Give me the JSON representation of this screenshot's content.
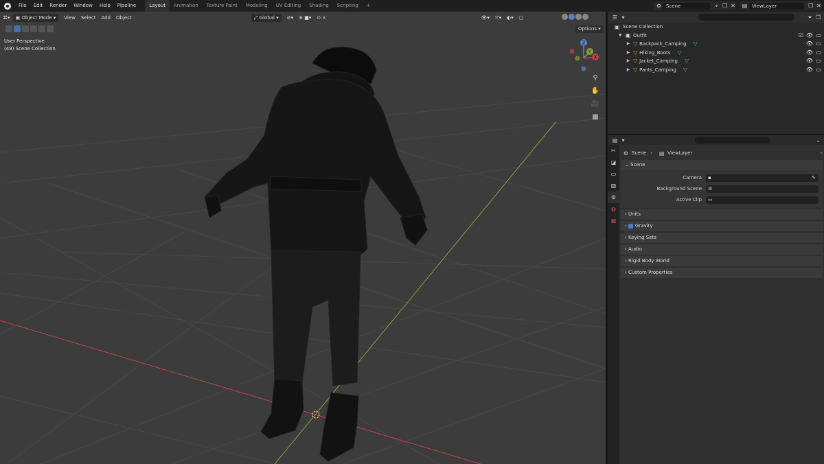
{
  "topbar": {
    "menu": [
      "File",
      "Edit",
      "Render",
      "Window",
      "Help",
      "Pipeline"
    ],
    "workspaces": [
      "Layout",
      "Animation",
      "Texture Paint",
      "Modeling",
      "UV Editing",
      "Shading",
      "Scripting",
      "+"
    ],
    "scene": "Scene",
    "view_layer": "ViewLayer"
  },
  "viewport": {
    "mode": "Object Mode",
    "header_menu": [
      "View",
      "Select",
      "Add",
      "Object"
    ],
    "orientation": "Global",
    "options": "Options",
    "perspective": "User Perspective",
    "collection_info": "(49) Scene Collection",
    "gizmo_axes": [
      "Z",
      "Y",
      "X"
    ]
  },
  "outliner": {
    "root": "Scene Collection",
    "collection": "Outfit",
    "objects": [
      "Backpack_Camping",
      "Hiking_Boots",
      "Jacket_Camping",
      "Pants_Camping"
    ]
  },
  "properties": {
    "breadcrumb": [
      "Scene",
      "ViewLayer"
    ],
    "scene_panel": "Scene",
    "fields": [
      {
        "label": "Camera"
      },
      {
        "label": "Background Scene"
      },
      {
        "label": "Active Clip"
      }
    ],
    "panels": [
      "Units",
      "Gravity",
      "Keying Sets",
      "Audio",
      "Rigid Body World",
      "Custom Properties"
    ]
  },
  "colors": {
    "viewport_bg": "#3c3c3c",
    "x_axis": "#c0404a",
    "y_axis": "#8aa03a",
    "outliner_object_icon": "#e08d3c",
    "material_icon": "#40c060",
    "accent": "#4d78c2"
  }
}
